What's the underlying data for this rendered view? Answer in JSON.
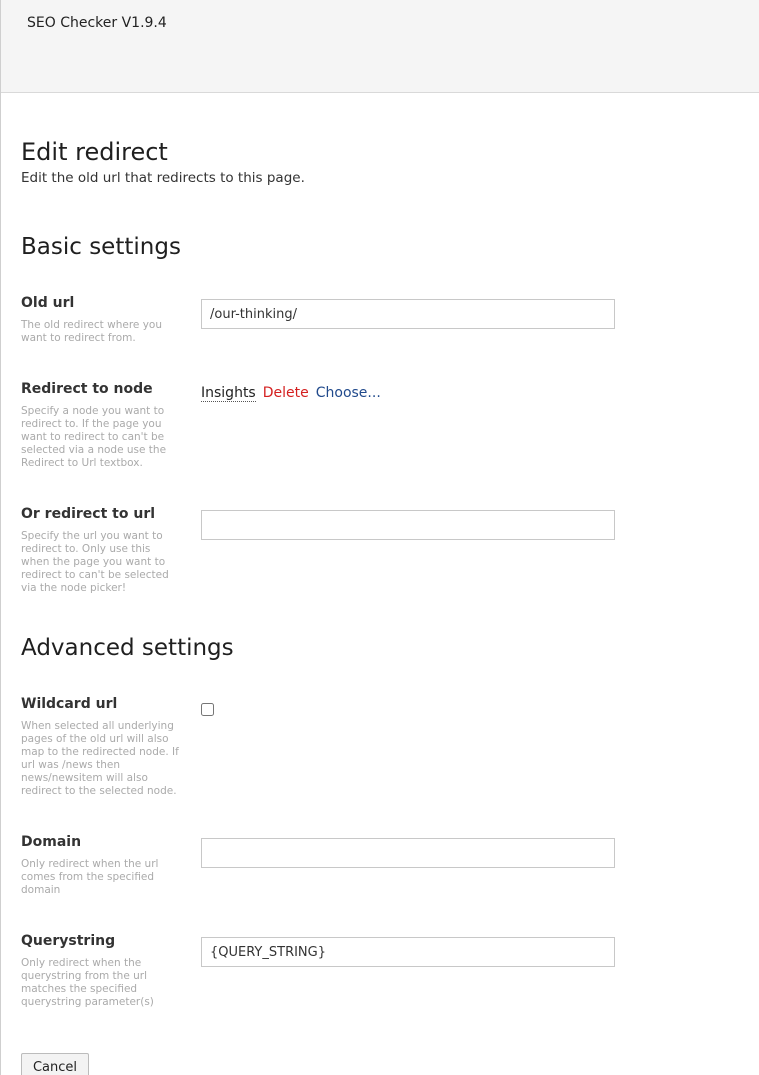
{
  "app": {
    "title": "SEO Checker V1.9.4"
  },
  "page": {
    "title": "Edit redirect",
    "subtitle": "Edit the old url that redirects to this page."
  },
  "basic_settings": {
    "title": "Basic settings",
    "old_url": {
      "label": "Old url",
      "help": "The old redirect where you want to redirect from.",
      "value": "/our-thinking/"
    },
    "redirect_to_node": {
      "label": "Redirect to node",
      "help": "Specify a node you want to redirect to. If the page you want to redirect to can't be selected via a node use the Redirect to Url textbox.",
      "node_name": "Insights",
      "delete_label": "Delete",
      "choose_label": "Choose..."
    },
    "redirect_to_url": {
      "label": "Or redirect to url",
      "help": "Specify the url you want to redirect to. Only use this when the page you want to redirect to can't be selected via the node picker!",
      "value": ""
    }
  },
  "advanced_settings": {
    "title": "Advanced settings",
    "wildcard_url": {
      "label": "Wildcard url",
      "help": "When selected all underlying pages of the old url will also map to the redirected node. If url was /news then news/newsitem will also redirect to the selected node.",
      "checked": false
    },
    "domain": {
      "label": "Domain",
      "help": "Only redirect when the url comes from the specified domain",
      "value": ""
    },
    "querystring": {
      "label": "Querystring",
      "help": "Only redirect when the querystring from the url matches the specified querystring parameter(s)",
      "value": "{QUERY_STRING}"
    }
  },
  "actions": {
    "cancel_label": "Cancel"
  }
}
